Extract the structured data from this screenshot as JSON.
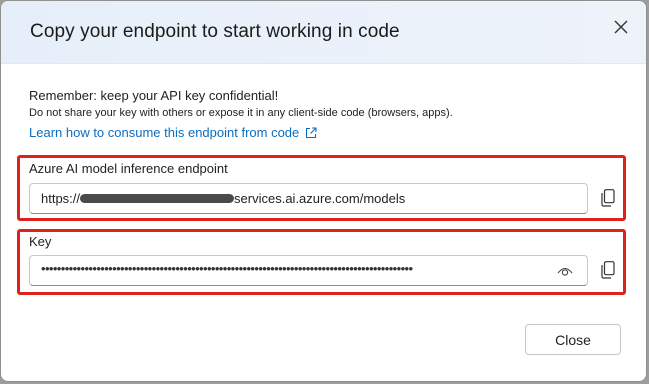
{
  "dialog": {
    "title": "Copy your endpoint to start working in code",
    "close_icon": "close-icon"
  },
  "notice": {
    "remember": "Remember: keep your API key confidential!",
    "warning": "Do not share your key with others or expose it in any client-side code (browsers, apps).",
    "learn_link": "Learn how to consume this endpoint from code",
    "learn_icon": "external-link-icon"
  },
  "endpoint": {
    "label": "Azure AI model inference endpoint",
    "prefix": "https://",
    "suffix": "services.ai.azure.com/models",
    "copy_icon": "copy-icon"
  },
  "key": {
    "label": "Key",
    "masked_value": "••••••••••••••••••••••••••••••••••••••••••••••••••••••••••••••••••••••••••••••••••••••••••••••",
    "reveal_icon": "eye-icon",
    "copy_icon": "copy-icon"
  },
  "footer": {
    "close_label": "Close"
  },
  "colors": {
    "highlight": "#e0221c",
    "link": "#0f6cbd",
    "header_bg": "#e6eff9"
  }
}
